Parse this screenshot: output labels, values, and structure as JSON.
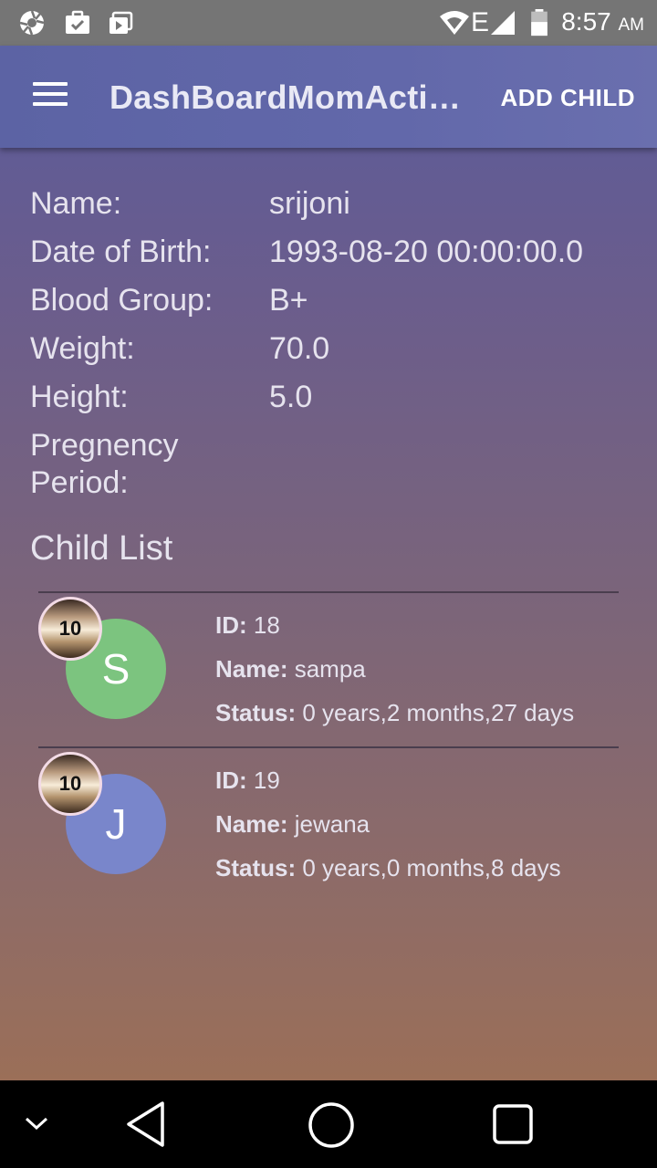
{
  "status_bar": {
    "time": "8:57",
    "ampm": "AM",
    "network": "E"
  },
  "app_bar": {
    "title": "DashBoardMomActi…",
    "action_label": "ADD CHILD"
  },
  "profile": {
    "name_label": "Name:",
    "name_value": "srijoni",
    "dob_label": "Date of Birth:",
    "dob_value": "1993-08-20 00:00:00.0",
    "blood_label": "Blood Group:",
    "blood_value": "B+",
    "weight_label": "Weight:",
    "weight_value": "70.0",
    "height_label": "Height:",
    "height_value": "5.0",
    "pregnancy_label_line1": "Pregnency",
    "pregnancy_label_line2": "Period:"
  },
  "child_list": {
    "title": "Child List",
    "id_label": "ID:",
    "name_label": "Name:",
    "status_label": "Status:",
    "items": [
      {
        "initial": "S",
        "badge": "10",
        "id": "18",
        "name": "sampa",
        "status": "0 years,2 months,27 days",
        "color": "#7cc47f"
      },
      {
        "initial": "J",
        "badge": "10",
        "id": "19",
        "name": "jewana",
        "status": "0 years,0 months,8 days",
        "color": "#7986cb"
      }
    ]
  },
  "colors": {
    "status_bar": "#757575",
    "app_bar": "#6268aa",
    "text": "#e6e3ee"
  }
}
